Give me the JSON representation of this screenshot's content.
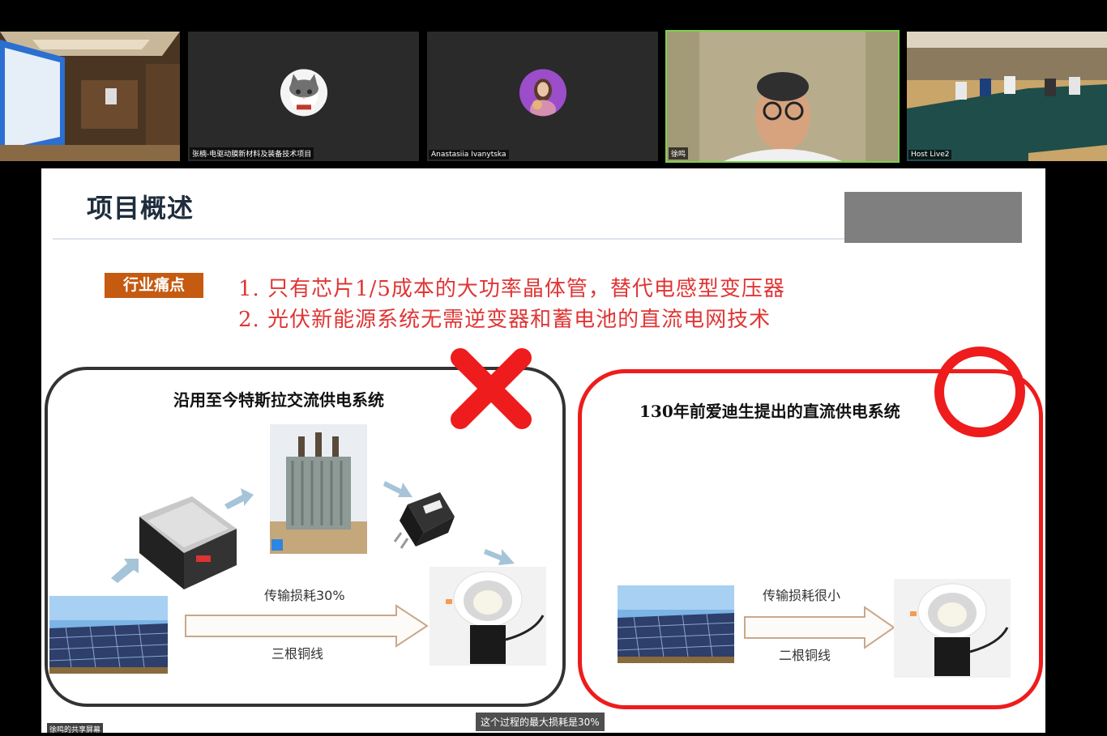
{
  "participants": [
    {
      "name": ""
    },
    {
      "name": "张楠-电驱动膜新材料及装备技术项目",
      "avatar_icon": "cat-avatar-icon"
    },
    {
      "name": "Anastasiia Ivanytska",
      "avatar_icon": "woman-avatar-icon"
    },
    {
      "name": "徐鸣"
    },
    {
      "name": "Host Live2"
    }
  ],
  "slide": {
    "title": "项目概述",
    "tag": "行业痛点",
    "pain_points": [
      "1. 只有芯片1/5成本的大功率晶体管，替代电感型变压器",
      "2. 光伏新能源系统无需逆变器和蓄电池的直流电网技术"
    ],
    "left_panel": {
      "title": "沿用至今特斯拉交流供电系统",
      "loss_label": "传输损耗30%",
      "wire_label": "三根铜线",
      "mark_icon": "red-x-icon"
    },
    "right_panel": {
      "title": "130年前爱迪生提出的直流供电系统",
      "loss_label": "传输损耗很小",
      "wire_label": "二根铜线",
      "mark_icon": "red-circle-icon"
    }
  },
  "share_label": "徐鸣的共享屏幕",
  "caption": "这个过程的最大损耗是30%",
  "colors": {
    "accent_red": "#ee1c1c",
    "tag_orange": "#c55a11",
    "pain_text": "#e03535"
  }
}
